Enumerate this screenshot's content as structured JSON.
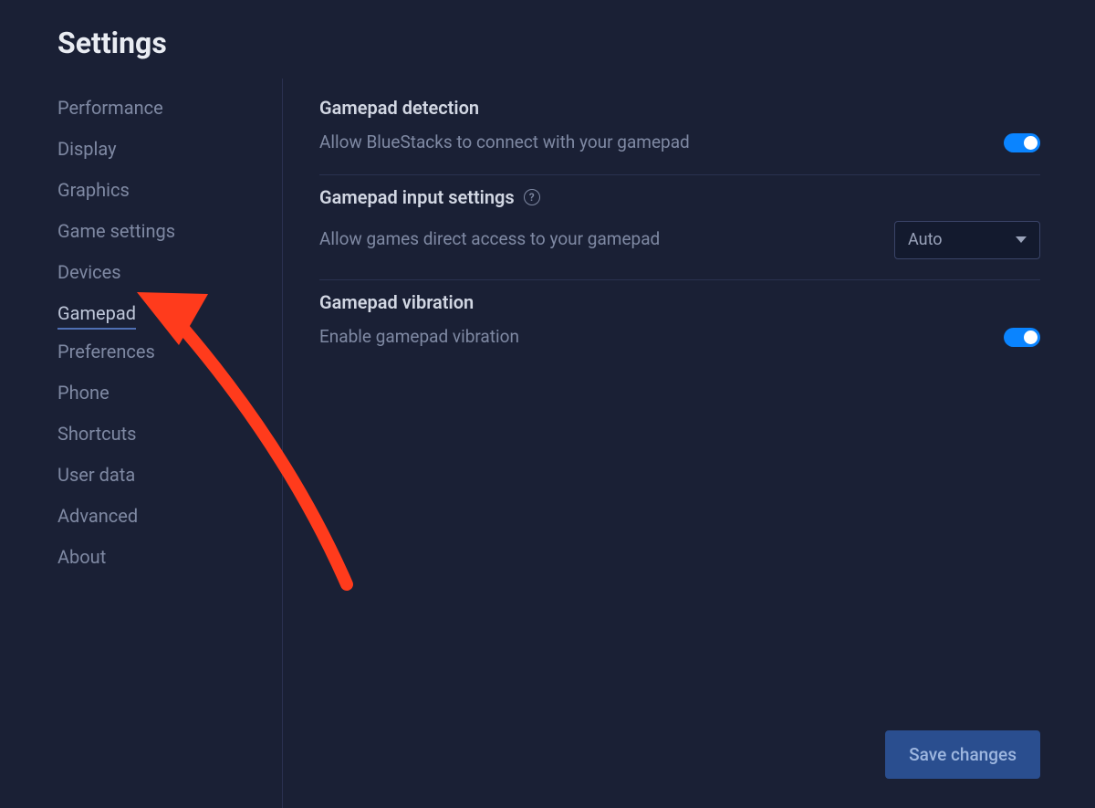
{
  "page": {
    "title": "Settings"
  },
  "sidebar": {
    "items": [
      {
        "label": "Performance",
        "name": "sidebar-item-performance",
        "active": false
      },
      {
        "label": "Display",
        "name": "sidebar-item-display",
        "active": false
      },
      {
        "label": "Graphics",
        "name": "sidebar-item-graphics",
        "active": false
      },
      {
        "label": "Game settings",
        "name": "sidebar-item-game-settings",
        "active": false
      },
      {
        "label": "Devices",
        "name": "sidebar-item-devices",
        "active": false
      },
      {
        "label": "Gamepad",
        "name": "sidebar-item-gamepad",
        "active": true
      },
      {
        "label": "Preferences",
        "name": "sidebar-item-preferences",
        "active": false
      },
      {
        "label": "Phone",
        "name": "sidebar-item-phone",
        "active": false
      },
      {
        "label": "Shortcuts",
        "name": "sidebar-item-shortcuts",
        "active": false
      },
      {
        "label": "User data",
        "name": "sidebar-item-user-data",
        "active": false
      },
      {
        "label": "Advanced",
        "name": "sidebar-item-advanced",
        "active": false
      },
      {
        "label": "About",
        "name": "sidebar-item-about",
        "active": false
      }
    ]
  },
  "main": {
    "sections": {
      "detection": {
        "title": "Gamepad detection",
        "desc": "Allow BlueStacks to connect with your gamepad",
        "toggle_on": true
      },
      "input": {
        "title": "Gamepad input settings",
        "desc": "Allow games direct access to your gamepad",
        "selected": "Auto"
      },
      "vibration": {
        "title": "Gamepad vibration",
        "desc": "Enable gamepad vibration",
        "toggle_on": true
      }
    }
  },
  "footer": {
    "save_label": "Save changes"
  },
  "colors": {
    "background": "#1a2035",
    "accent": "#0a84ff",
    "annotation": "#ff3b1c"
  }
}
